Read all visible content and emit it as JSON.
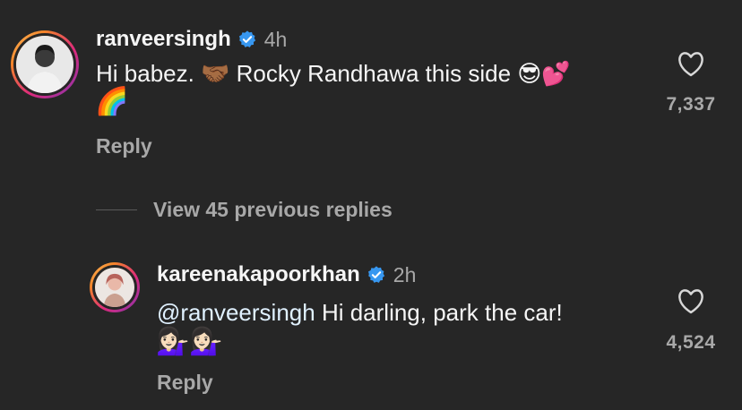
{
  "comments": [
    {
      "username": "ranveersingh",
      "time": "4h",
      "text_line1": "Hi babez. 🤝🏾 Rocky Randhawa this side 😎💕",
      "text_line2": "🌈",
      "reply_label": "Reply",
      "likes": "7,337"
    },
    {
      "username": "kareenakapoorkhan",
      "time": "2h",
      "mention": "@ranveersingh",
      "text": " Hi darling, park the car!",
      "text_line2": "💁🏻‍♀️💁🏻‍♀️",
      "reply_label": "Reply",
      "likes": "4,524"
    }
  ],
  "view_replies": "View 45 previous replies",
  "icons": {
    "verified": "verified-badge-icon",
    "heart": "heart-outline-icon"
  },
  "colors": {
    "background": "#262626",
    "verified": "#3797f0",
    "secondary_text": "#a8a8a8"
  }
}
